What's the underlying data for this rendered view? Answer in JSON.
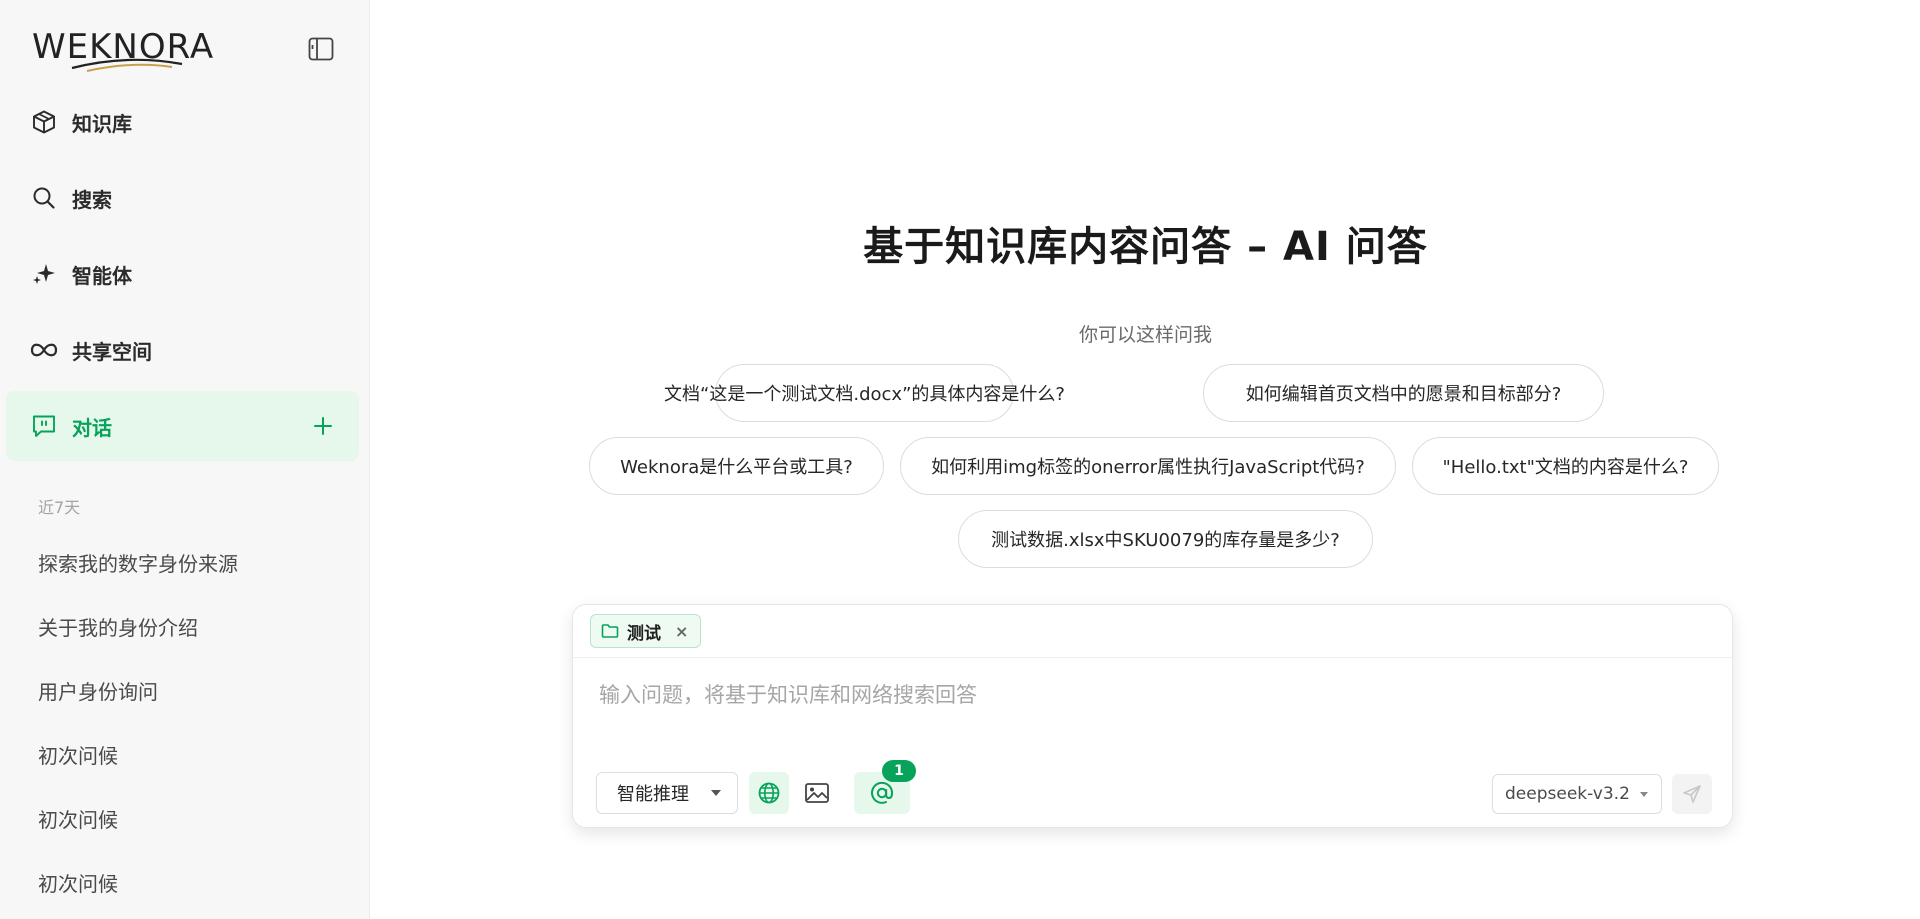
{
  "brand": {
    "logo_text": "WEKNORA"
  },
  "sidebar": {
    "nav": [
      {
        "label": "知识库",
        "icon": "cube-icon"
      },
      {
        "label": "搜索",
        "icon": "search-icon"
      },
      {
        "label": "智能体",
        "icon": "sparkle-icon"
      },
      {
        "label": "共享空间",
        "icon": "infinity-icon"
      },
      {
        "label": "对话",
        "icon": "chat-icon",
        "active": true
      }
    ],
    "section_label": "近7天",
    "history": [
      "探索我的数字身份来源",
      "关于我的身份介绍",
      "用户身份询问",
      "初次问候",
      "初次问候",
      "初次问候"
    ]
  },
  "main": {
    "title": "基于知识库内容问答 – AI 问答",
    "subtitle": "你可以这样问我",
    "suggestions": [
      "文档“这是一个测试文档.docx”的具体内容是什么?",
      "如何编辑首页文档中的愿景和目标部分?",
      "Weknora是什么平台或工具?",
      "如何利用img标签的onerror属性执行JavaScript代码?",
      "\"Hello.txt\"文档的内容是什么?",
      "测试数据.xlsx中SKU0079的库存量是多少?"
    ]
  },
  "composer": {
    "kb_tag": "测试",
    "kb_tag_close": "×",
    "placeholder": "输入问题，将基于知识库和网络搜索回答",
    "mode": "智能推理",
    "mention_count": "1",
    "model": "deepseek-v3.2"
  },
  "colors": {
    "accent": "#07a35a",
    "accent_bg": "#e6f7ec",
    "sidebar_bg": "#f7f7f7"
  }
}
